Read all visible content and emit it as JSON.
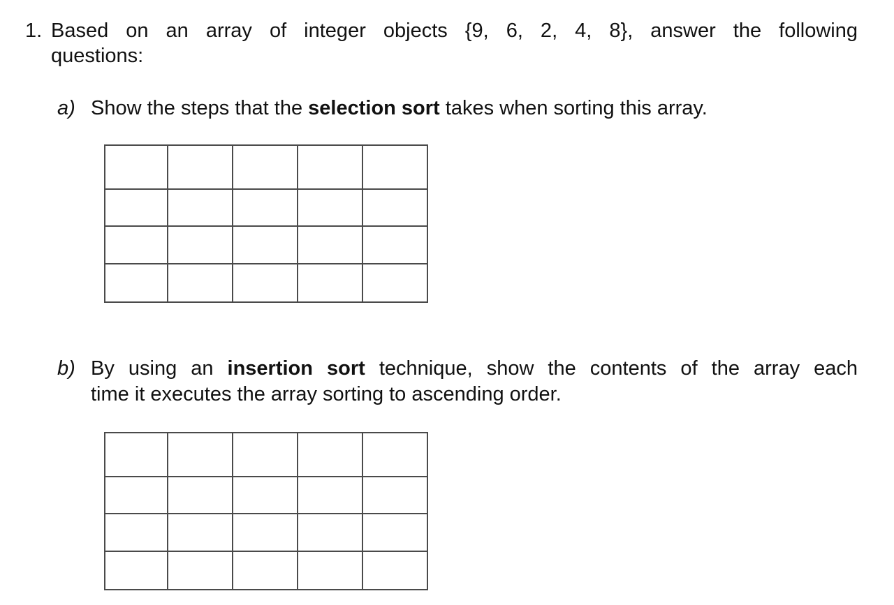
{
  "question": {
    "number": "1.",
    "text_line1": "Based on an array of integer objects {9, 6, 2, 4, 8}, answer the following",
    "text_line2": "questions:",
    "array": [
      9,
      6,
      2,
      4,
      8
    ]
  },
  "part_a": {
    "label": "a)",
    "text_before": "Show the steps that the ",
    "bold": "selection sort",
    "text_after": " takes when sorting this array.",
    "table": {
      "columns": 5,
      "rows": [
        [
          "",
          "",
          "",
          "",
          ""
        ],
        [
          "",
          "",
          "",
          "",
          ""
        ],
        [
          "",
          "",
          "",
          "",
          ""
        ],
        [
          "",
          "",
          "",
          "",
          ""
        ]
      ]
    }
  },
  "part_b": {
    "label": "b)",
    "text_before": "By using an ",
    "bold": "insertion sort",
    "text_after_line1": " technique, show the contents of the array each",
    "text_line2": "time it executes the array sorting to ascending order.",
    "table": {
      "columns": 5,
      "rows": [
        [
          "",
          "",
          "",
          "",
          ""
        ],
        [
          "",
          "",
          "",
          "",
          ""
        ],
        [
          "",
          "",
          "",
          "",
          ""
        ],
        [
          "",
          "",
          "",
          "",
          ""
        ]
      ]
    }
  }
}
